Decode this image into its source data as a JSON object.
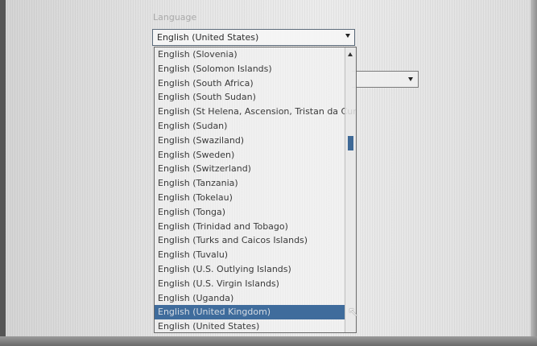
{
  "language": {
    "label": "Language",
    "selected_value": "English (United States)"
  },
  "dropdown": {
    "items": [
      {
        "label": "English (Slovenia)",
        "selected": false
      },
      {
        "label": "English (Solomon Islands)",
        "selected": false
      },
      {
        "label": "English (South Africa)",
        "selected": false
      },
      {
        "label": "English (South Sudan)",
        "selected": false
      },
      {
        "label": "English (St Helena, Ascension, Tristan da Cunha)",
        "selected": false
      },
      {
        "label": "English (Sudan)",
        "selected": false
      },
      {
        "label": "English (Swaziland)",
        "selected": false
      },
      {
        "label": "English (Sweden)",
        "selected": false
      },
      {
        "label": "English (Switzerland)",
        "selected": false
      },
      {
        "label": "English (Tanzania)",
        "selected": false
      },
      {
        "label": "English (Tokelau)",
        "selected": false
      },
      {
        "label": "English (Tonga)",
        "selected": false
      },
      {
        "label": "English (Trinidad and Tobago)",
        "selected": false
      },
      {
        "label": "English (Turks and Caicos Islands)",
        "selected": false
      },
      {
        "label": "English (Tuvalu)",
        "selected": false
      },
      {
        "label": "English (U.S. Outlying Islands)",
        "selected": false
      },
      {
        "label": "English (U.S. Virgin Islands)",
        "selected": false
      },
      {
        "label": "English (Uganda)",
        "selected": false
      },
      {
        "label": "English (United Kingdom)",
        "selected": true
      },
      {
        "label": "English (United States)",
        "selected": false
      }
    ]
  },
  "colors": {
    "selection": "#3f6c9c",
    "scroll_thumb": "#3e6996"
  }
}
